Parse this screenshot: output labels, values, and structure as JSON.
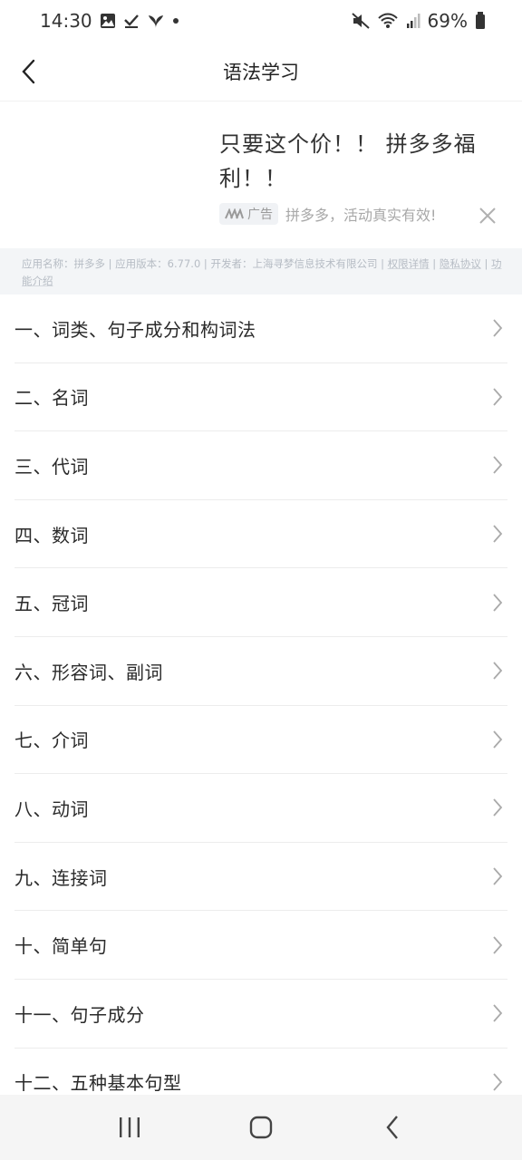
{
  "status_bar": {
    "time": "14:30",
    "battery": "69%"
  },
  "header": {
    "title": "语法学习"
  },
  "ad": {
    "title": "只要这个价！！ 拼多多福利！！",
    "tag": "广告",
    "description": "拼多多，活动真实有效!"
  },
  "app_info": {
    "text": "应用名称：拼多多 | 应用版本：6.77.0 | 开发者：上海寻梦信息技术有限公司 | ",
    "permission_link": "权限详情",
    "sep": " | ",
    "privacy_link": "隐私协议",
    "sep2": " | ",
    "feature_link": "功能介绍"
  },
  "list": {
    "items": [
      {
        "label": "一、词类、句子成分和构词法"
      },
      {
        "label": "二、名词"
      },
      {
        "label": "三、代词"
      },
      {
        "label": "四、数词"
      },
      {
        "label": "五、冠词"
      },
      {
        "label": "六、形容词、副词"
      },
      {
        "label": "七、介词"
      },
      {
        "label": "八、动词"
      },
      {
        "label": "九、连接词"
      },
      {
        "label": "十、简单句"
      },
      {
        "label": "十一、句子成分"
      },
      {
        "label": "十二、五种基本句型"
      }
    ]
  },
  "icons": {
    "back": "chevron-left-icon",
    "row": "chevron-right-icon",
    "close": "close-icon",
    "nav_recent": "recent-apps-icon",
    "nav_home": "home-icon",
    "nav_back": "back-icon"
  },
  "colors": {
    "background": "#ffffff",
    "info_bar": "#f3f5f7",
    "nav_bar": "#f5f5f5",
    "divider": "#ececec"
  }
}
